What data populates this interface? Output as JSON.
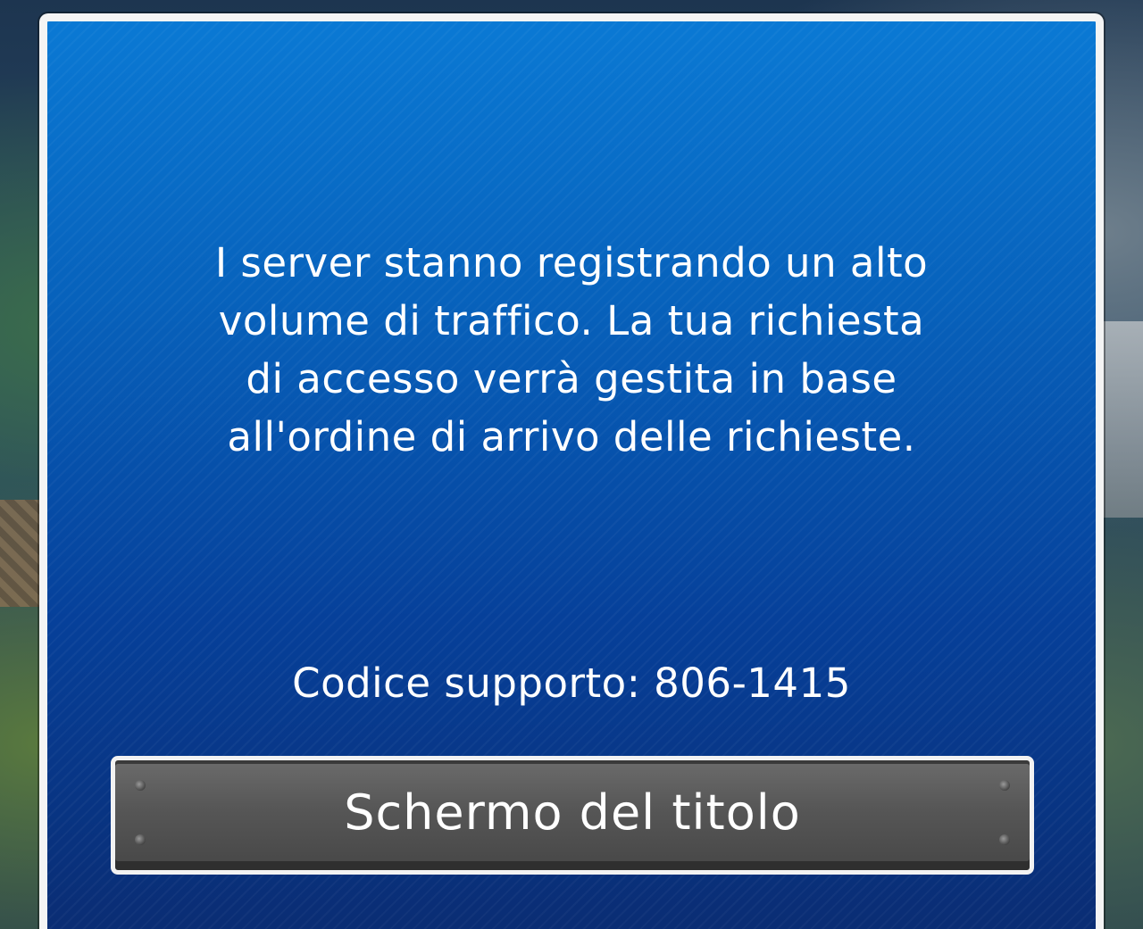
{
  "dialog": {
    "message": "I server stanno registrando un alto\nvolume di traffico. La tua richiesta\ndi accesso verrà gestita in base\nall'ordine di arrivo delle richieste.",
    "support_code": "Codice supporto: 806-1415",
    "button_label": "Schermo del titolo"
  },
  "colors": {
    "dialog_top": "#0a79d4",
    "dialog_bottom": "#0a2c72",
    "border": "#f4f4f4",
    "button": "#565656"
  }
}
